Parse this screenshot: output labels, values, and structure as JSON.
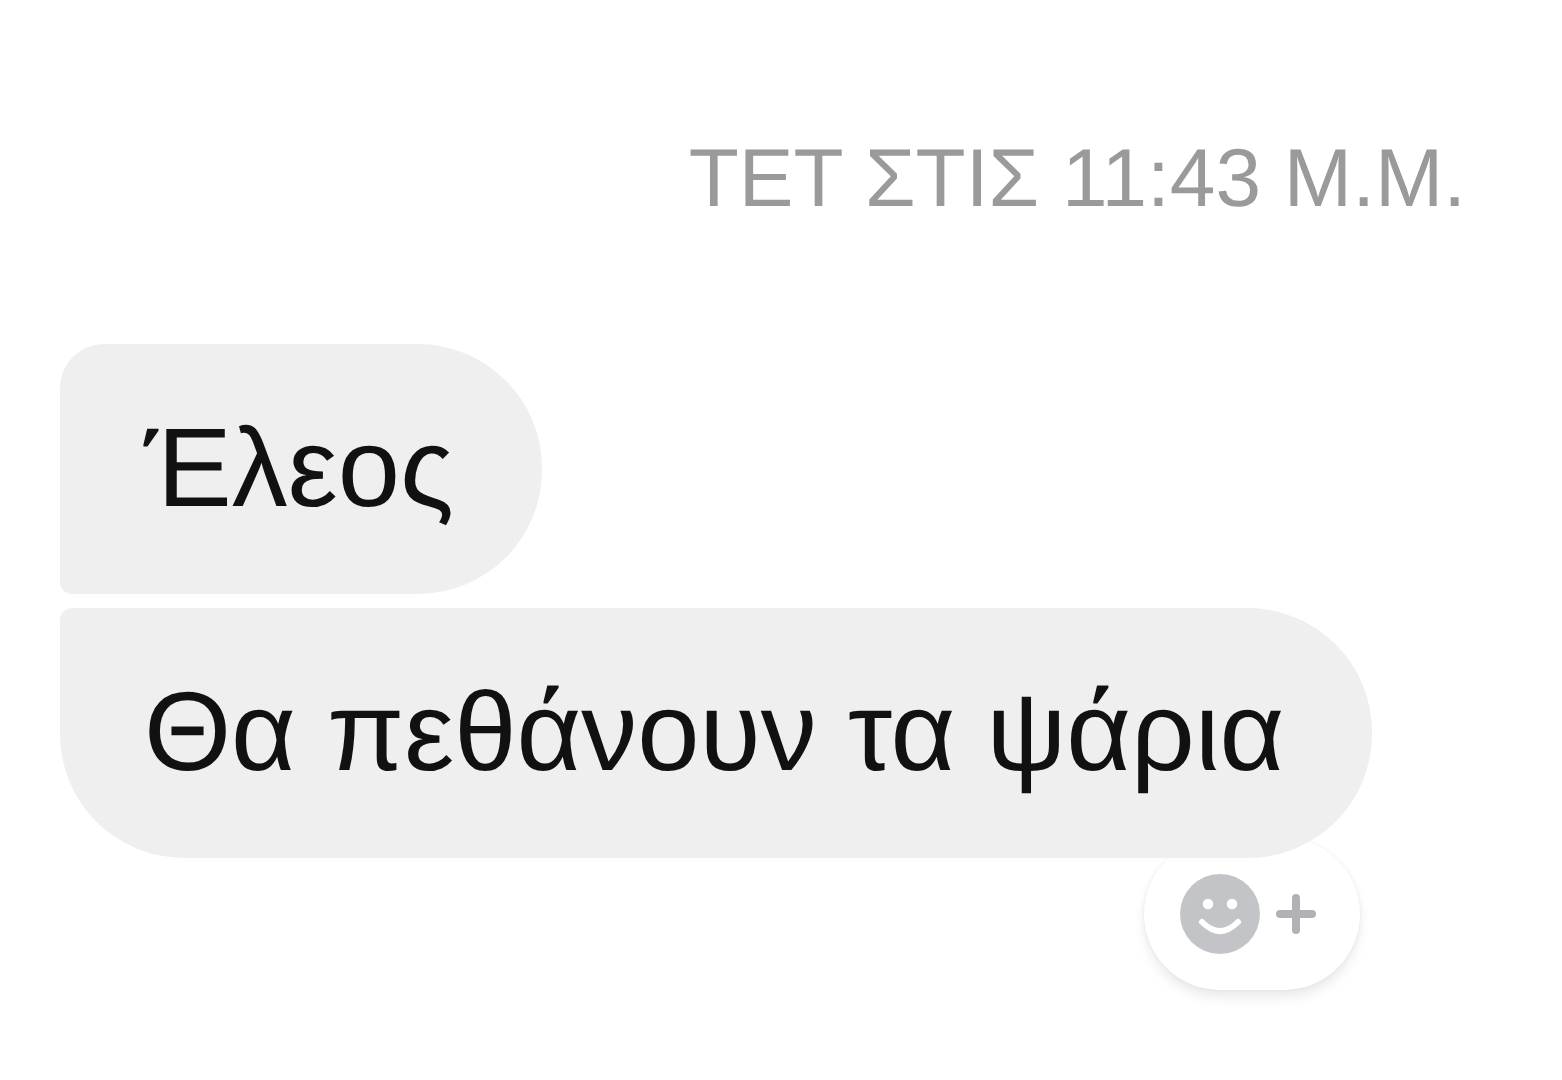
{
  "timestamp": "ΤΕΤ ΣΤΙΣ 11:43 Μ.Μ.",
  "messages": [
    {
      "text": "Έλεος",
      "kind": "first"
    },
    {
      "text": "Θα πεθάνουν τα ψάρια",
      "kind": "last"
    }
  ]
}
